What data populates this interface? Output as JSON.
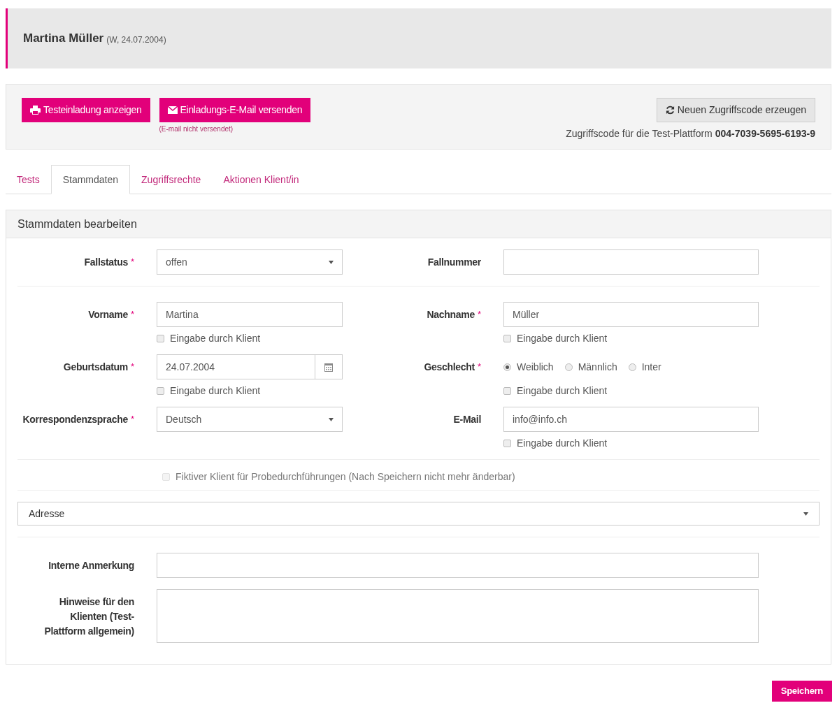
{
  "header": {
    "name": "Martina Müller",
    "meta": "(W, 24.07.2004)"
  },
  "actions": {
    "buttons": [
      {
        "label": "Testeinladung anzeigen",
        "kind": "print"
      },
      {
        "label": "Einladungs-E-Mail versenden",
        "kind": "mail"
      }
    ],
    "email_note": "(E-mail nicht versendet)",
    "regenerate_button": "Neuen Zugriffscode erzeugen",
    "access_code_label": "Zugriffscode für die Test-Plattform",
    "access_code": "004-7039-5695-6193-9"
  },
  "tabs": [
    {
      "label": "Tests",
      "selected": false
    },
    {
      "label": "Stammdaten",
      "selected": true
    },
    {
      "label": "Zugriffsrechte",
      "selected": false
    },
    {
      "label": "Aktionen Klient/in",
      "selected": false
    }
  ],
  "form": {
    "title": "Stammdaten bearbeiten",
    "sections": [
      {
        "fields": [
          {
            "label": "Fallstatus",
            "required_mark": "*",
            "kind": "select",
            "value": "offen"
          },
          {
            "label": "Fallnummer",
            "kind": "text"
          }
        ]
      },
      {
        "fields": [
          {
            "label": "Vorname",
            "required_mark": "*",
            "kind": "text",
            "value": "Martina",
            "client_input": {
              "label": "Eingabe durch Klient",
              "checked": false
            }
          },
          {
            "label": "Nachname",
            "required_mark": "*",
            "kind": "text",
            "value": "Müller",
            "client_input": {
              "label": "Eingabe durch Klient",
              "checked": false
            }
          },
          {
            "label": "Geburtsdatum",
            "required_mark": "*",
            "kind": "date",
            "value": "24.07.2004",
            "client_input": {
              "label": "Eingabe durch Klient",
              "checked": false
            }
          },
          {
            "label": "Geschlecht",
            "required_mark": "*",
            "kind": "radio",
            "options": [
              {
                "label": "Weiblich",
                "selected": true
              },
              {
                "label": "Männlich",
                "selected": false
              },
              {
                "label": "Inter",
                "selected": false
              }
            ],
            "client_input": {
              "label": "Eingabe durch Klient",
              "checked": false
            }
          },
          {
            "label": "Korrespondenzsprache",
            "required_mark": "*",
            "kind": "select",
            "value": "Deutsch"
          },
          {
            "label": "E-Mail",
            "kind": "text",
            "value": "info@info.ch",
            "client_input": {
              "label": "Eingabe durch Klient",
              "checked": false
            }
          }
        ]
      }
    ],
    "fictitious": {
      "label": "Fiktiver Klient für Probedurchführungen (Nach Speichern nicht mehr änderbar)",
      "checked": false,
      "disabled": true
    },
    "address": {
      "label": "Adresse",
      "expanded": false
    },
    "notes": [
      {
        "label": "Interne Anmerkung",
        "kind": "line"
      },
      {
        "label": "Hinweise für den Klienten (Test-Plattform allgemein)",
        "kind": "area"
      }
    ]
  },
  "save_button": "Speichern"
}
